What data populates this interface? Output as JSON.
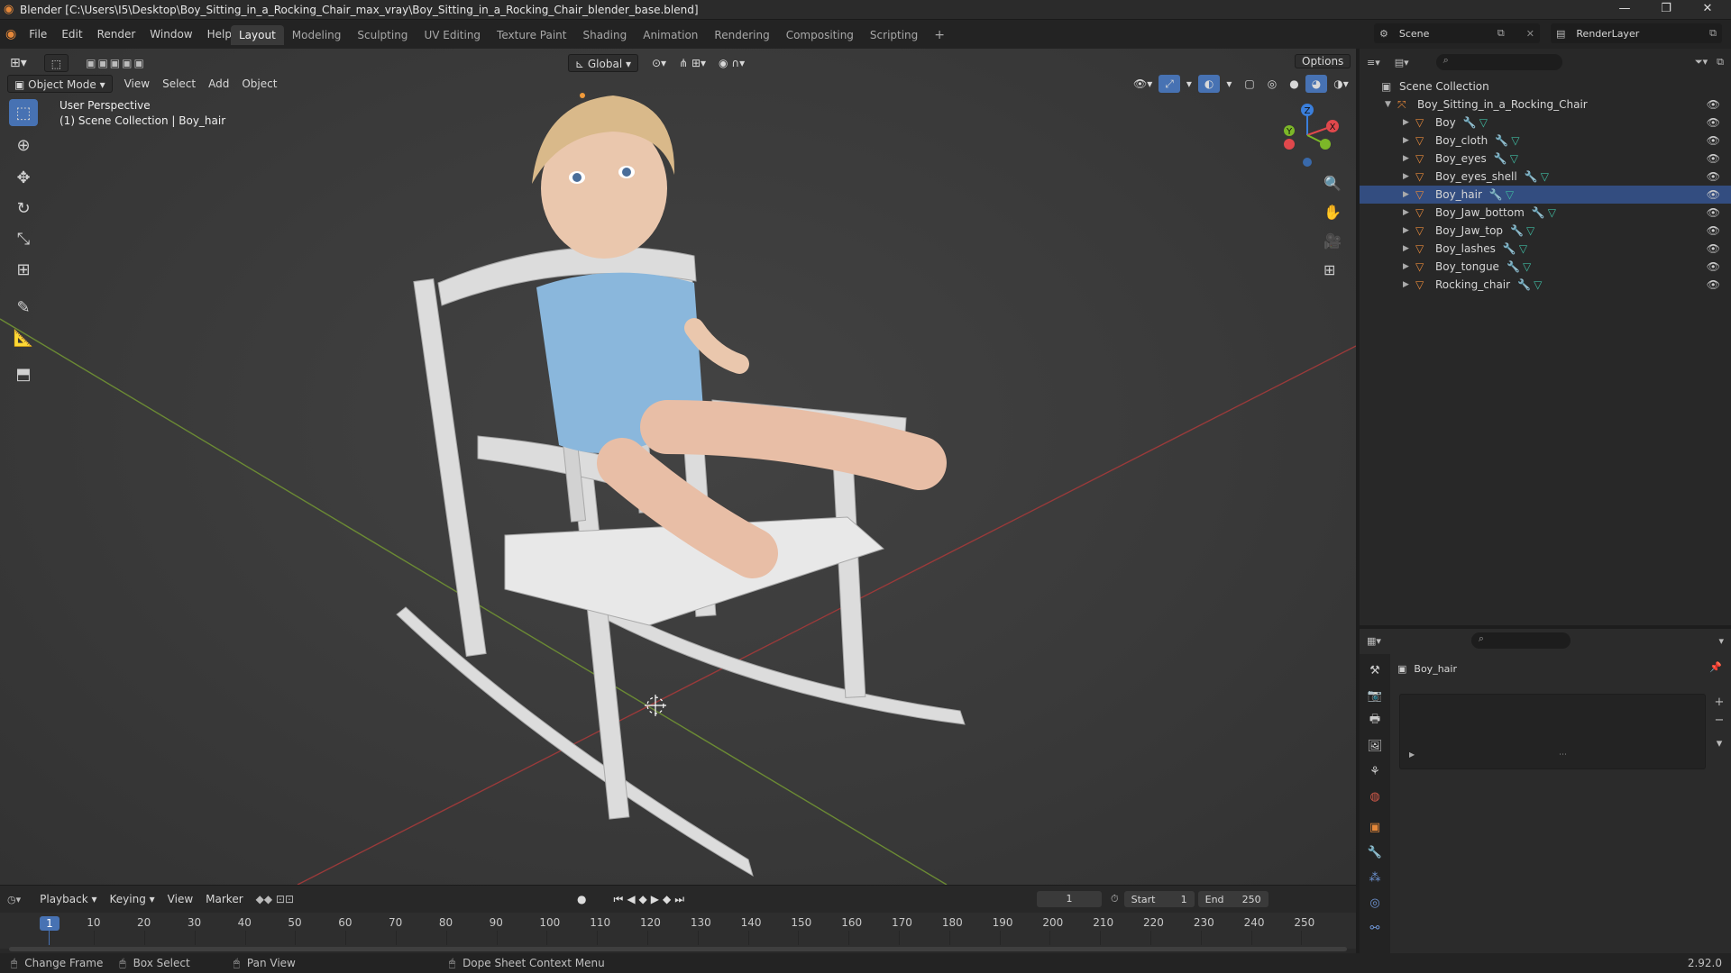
{
  "window": {
    "title": "Blender [C:\\Users\\I5\\Desktop\\Boy_Sitting_in_a_Rocking_Chair_max_vray\\Boy_Sitting_in_a_Rocking_Chair_blender_base.blend]",
    "controls": [
      "—",
      "❐",
      "✕"
    ]
  },
  "menu": [
    "File",
    "Edit",
    "Render",
    "Window",
    "Help"
  ],
  "workspaces": [
    "Layout",
    "Modeling",
    "Sculpting",
    "UV Editing",
    "Texture Paint",
    "Shading",
    "Animation",
    "Rendering",
    "Compositing",
    "Scripting"
  ],
  "active_workspace": "Layout",
  "scene": {
    "label": "Scene",
    "render_layer": "RenderLayer"
  },
  "viewport": {
    "mode": "Object Mode",
    "menus": [
      "View",
      "Select",
      "Add",
      "Object"
    ],
    "transform_orientation": "Global",
    "options_label": "Options",
    "overlay_line1": "User Perspective",
    "overlay_line2": "(1) Scene Collection | Boy_hair",
    "gizmo_axes": {
      "x": "X",
      "y": "Y",
      "z": "Z"
    }
  },
  "outliner": {
    "root": "Scene Collection",
    "collection": "Boy_Sitting_in_a_Rocking_Chair",
    "objects": [
      "Boy",
      "Boy_cloth",
      "Boy_eyes",
      "Boy_eyes_shell",
      "Boy_hair",
      "Boy_Jaw_bottom",
      "Boy_Jaw_top",
      "Boy_lashes",
      "Boy_tongue",
      "Rocking_chair"
    ],
    "selected": "Boy_hair"
  },
  "properties": {
    "object_name": "Boy_hair"
  },
  "timeline": {
    "menus": [
      "Playback",
      "Keying",
      "View",
      "Marker"
    ],
    "current_frame": "1",
    "start_label": "Start",
    "start": "1",
    "end_label": "End",
    "end": "250",
    "ticks": [
      "1",
      "10",
      "20",
      "30",
      "40",
      "50",
      "60",
      "70",
      "80",
      "90",
      "100",
      "110",
      "120",
      "130",
      "140",
      "150",
      "160",
      "170",
      "180",
      "190",
      "200",
      "210",
      "220",
      "230",
      "240",
      "250"
    ]
  },
  "statusbar": {
    "hints": [
      "Change Frame",
      "Box Select",
      "Pan View",
      "Dope Sheet Context Menu"
    ],
    "version": "2.92.0"
  },
  "colors": {
    "accent": "#4772b3",
    "axis_x": "#e0484c",
    "axis_y": "#7cb728",
    "axis_z": "#3a7fdc",
    "object_icon": "#e5883a",
    "modifier_icon": "#6f96d6",
    "mesh_icon": "#3fb9a0"
  }
}
